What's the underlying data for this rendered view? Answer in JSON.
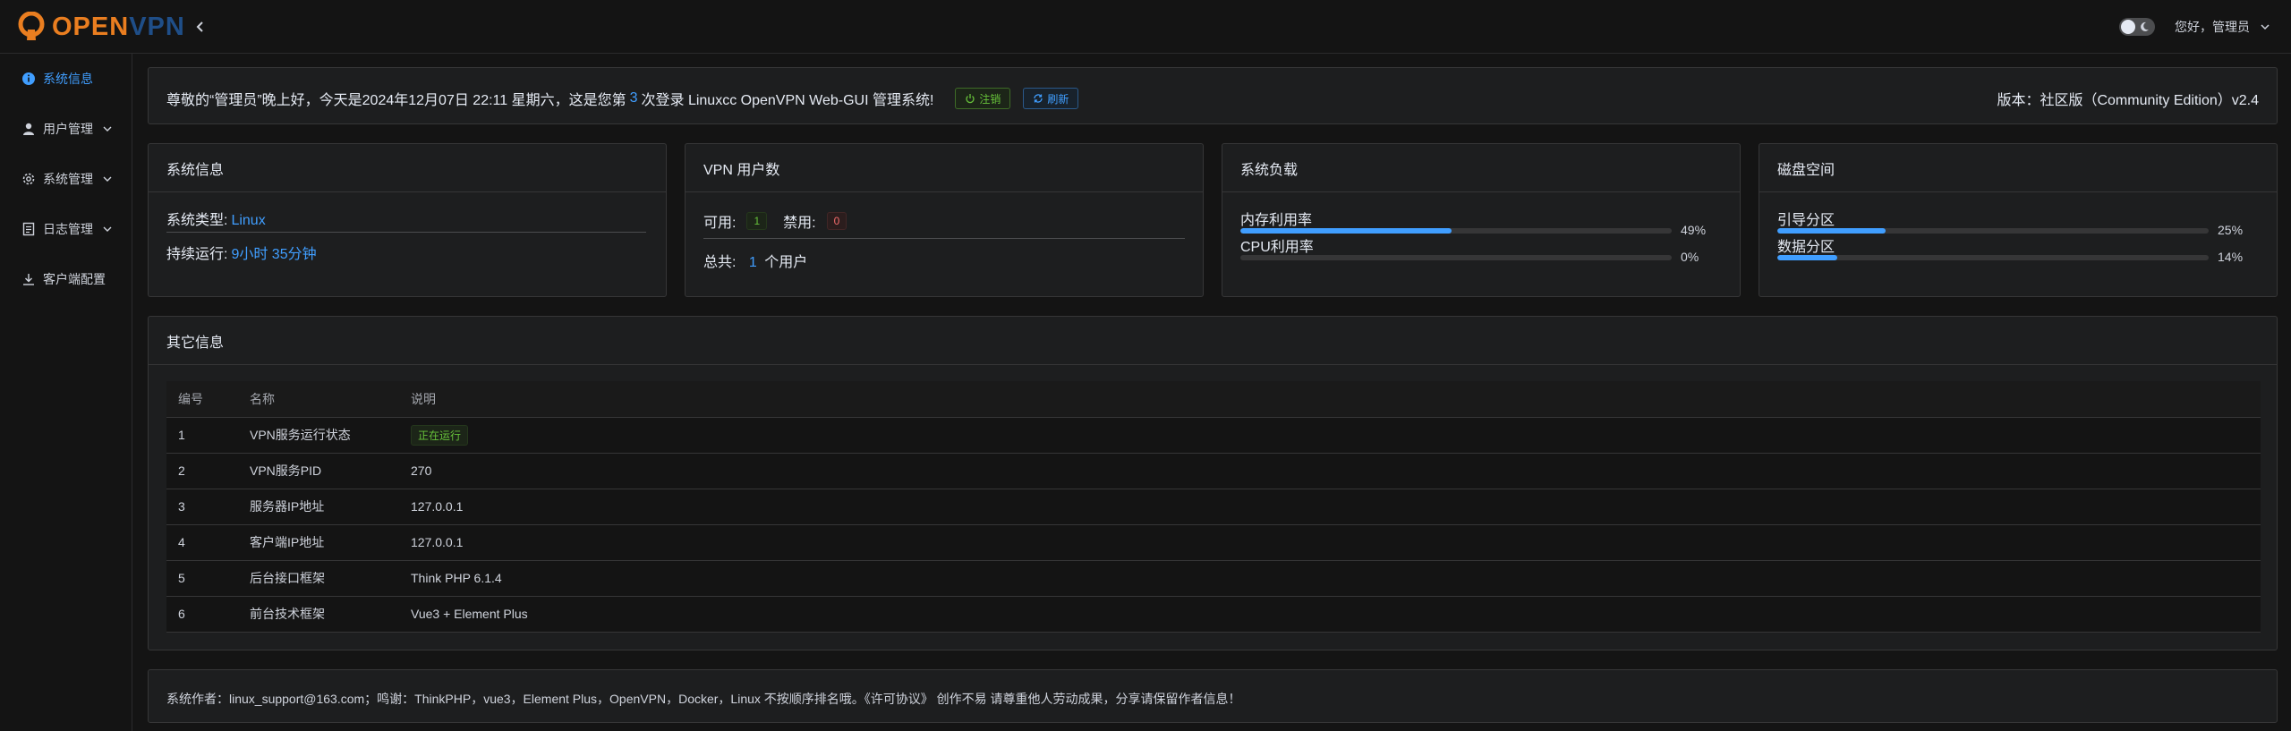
{
  "header": {
    "logo_open": "OPEN",
    "logo_vpn": "VPN",
    "greeting": "您好，管理员"
  },
  "sidebar": {
    "items": [
      {
        "label": "系统信息",
        "icon": "info-circle-icon",
        "active": true,
        "has_children": false
      },
      {
        "label": "用户管理",
        "icon": "user-icon",
        "active": false,
        "has_children": true
      },
      {
        "label": "系统管理",
        "icon": "gear-icon",
        "active": false,
        "has_children": true
      },
      {
        "label": "日志管理",
        "icon": "document-icon",
        "active": false,
        "has_children": true
      },
      {
        "label": "客户端配置",
        "icon": "download-icon",
        "active": false,
        "has_children": false
      }
    ]
  },
  "welcome": {
    "text_before": "尊敬的“管理员”晚上好，今天是2024年12月07日 22:11 星期六，这是您第",
    "login_count": "3",
    "text_after": "次登录 Linuxcc OpenVPN Web-GUI 管理系统!",
    "logout_label": "注销",
    "refresh_label": "刷新",
    "version": "版本：社区版（Community Edition）v2.4"
  },
  "system_info": {
    "title": "系统信息",
    "type_label": "系统类型:",
    "type_value": "Linux",
    "uptime_label": "持续运行:",
    "uptime_value": "9小时 35分钟"
  },
  "vpn_users": {
    "title": "VPN 用户数",
    "enabled_label": "可用:",
    "enabled_count": "1",
    "disabled_label": "禁用:",
    "disabled_count": "0",
    "total_label": "总共:",
    "total_count": "1",
    "total_unit": "个用户"
  },
  "load": {
    "title": "系统负载",
    "metrics": [
      {
        "label": "内存利用率",
        "percent": 49,
        "text": "49%"
      },
      {
        "label": "CPU利用率",
        "percent": 0,
        "text": "0%"
      }
    ]
  },
  "disk": {
    "title": "磁盘空间",
    "metrics": [
      {
        "label": "引导分区",
        "percent": 25,
        "text": "25%"
      },
      {
        "label": "数据分区",
        "percent": 14,
        "text": "14%"
      }
    ]
  },
  "other": {
    "title": "其它信息",
    "columns": [
      "编号",
      "名称",
      "说明"
    ],
    "rows": [
      {
        "id": "1",
        "name": "VPN服务运行状态",
        "desc": "正在运行",
        "is_tag": true
      },
      {
        "id": "2",
        "name": "VPN服务PID",
        "desc": "270",
        "is_tag": false
      },
      {
        "id": "3",
        "name": "服务器IP地址",
        "desc": "127.0.0.1",
        "is_tag": false
      },
      {
        "id": "4",
        "name": "客户端IP地址",
        "desc": "127.0.0.1",
        "is_tag": false
      },
      {
        "id": "5",
        "name": "后台接口框架",
        "desc": "Think PHP 6.1.4",
        "is_tag": false
      },
      {
        "id": "6",
        "name": "前台技术框架",
        "desc": "Vue3 + Element Plus",
        "is_tag": false
      }
    ]
  },
  "footer": {
    "text": "系统作者：linux_support@163.com；鸣谢：ThinkPHP，vue3，Element Plus，OpenVPN，Docker，Linux 不按顺序排名哦。《许可协议》 创作不易 请尊重他人劳动成果，分享请保留作者信息！"
  },
  "colors": {
    "accent": "#409eff",
    "success": "#67c23a",
    "danger": "#f56c6c",
    "logo_orange": "#ea7e20",
    "logo_blue": "#1f4e88"
  }
}
